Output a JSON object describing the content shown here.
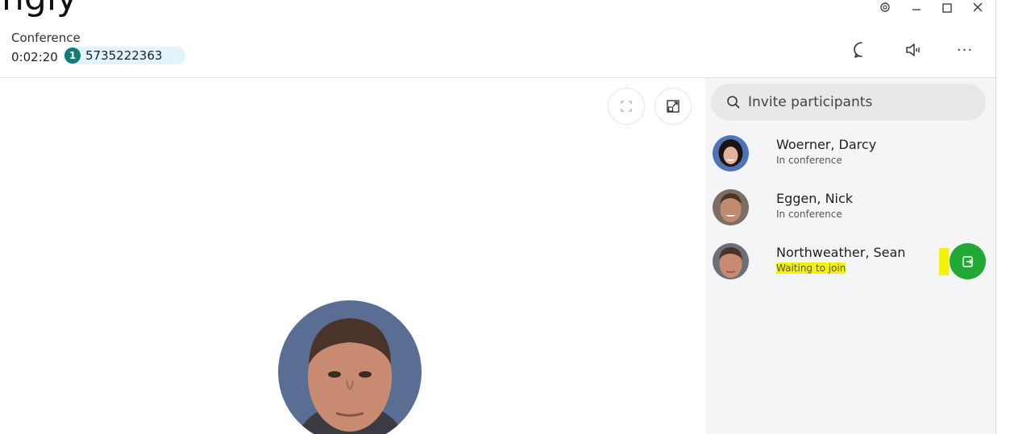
{
  "window": {
    "cutoff_text": "ngly",
    "settings_icon": "gear-icon",
    "minimize_icon": "minimize-icon",
    "maximize_icon": "maximize-icon",
    "close_icon": "close-icon"
  },
  "header": {
    "title": "Conference",
    "timer": "0:02:20",
    "badge_count": "1",
    "phone_number": "5735222363",
    "chat_icon": "chat-icon",
    "speaker_icon": "speaker-icon",
    "more_icon": "more-icon",
    "more_label": "···"
  },
  "stage": {
    "fullscreen_icon": "fullscreen-icon",
    "popout_icon": "popout-icon",
    "main_avatar": "participant-photo"
  },
  "sidebar": {
    "search_placeholder": "Invite participants",
    "participants": [
      {
        "name": "Woerner, Darcy",
        "status": "In conference"
      },
      {
        "name": "Eggen, Nick",
        "status": "In conference"
      },
      {
        "name": "Northweather, Sean",
        "status": "Waiting to join",
        "action_icon": "admit-icon"
      }
    ]
  },
  "colors": {
    "accent_teal": "#147a7a",
    "admit_green": "#22a834",
    "highlight_yellow": "#f4f400",
    "sidebar_bg": "#f4f5f6"
  }
}
